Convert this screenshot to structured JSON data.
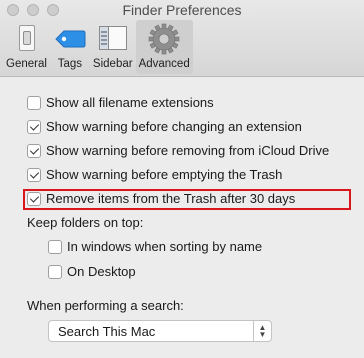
{
  "window": {
    "title": "Finder Preferences"
  },
  "toolbar": {
    "tabs": [
      {
        "label": "General",
        "icon": "switch-icon"
      },
      {
        "label": "Tags",
        "icon": "tag-icon"
      },
      {
        "label": "Sidebar",
        "icon": "sidebar-icon"
      },
      {
        "label": "Advanced",
        "icon": "gear-icon",
        "active": true
      }
    ]
  },
  "options": {
    "show_extensions": {
      "label": "Show all filename extensions",
      "checked": false
    },
    "warn_extension_change": {
      "label": "Show warning before changing an extension",
      "checked": true
    },
    "warn_icloud_remove": {
      "label": "Show warning before removing from iCloud Drive",
      "checked": true
    },
    "warn_empty_trash": {
      "label": "Show warning before emptying the Trash",
      "checked": true
    },
    "remove_trash_30": {
      "label": "Remove items from the Trash after 30 days",
      "checked": true
    }
  },
  "folders_on_top": {
    "heading": "Keep folders on top:",
    "windows": {
      "label": "In windows when sorting by name",
      "checked": false
    },
    "desktop": {
      "label": "On Desktop",
      "checked": false
    }
  },
  "search": {
    "heading": "When performing a search:",
    "selected": "Search This Mac"
  },
  "colors": {
    "highlight": "#d9161c",
    "tag_blue": "#2e8fe6",
    "active_tab_bg": "#cfcfcf"
  }
}
